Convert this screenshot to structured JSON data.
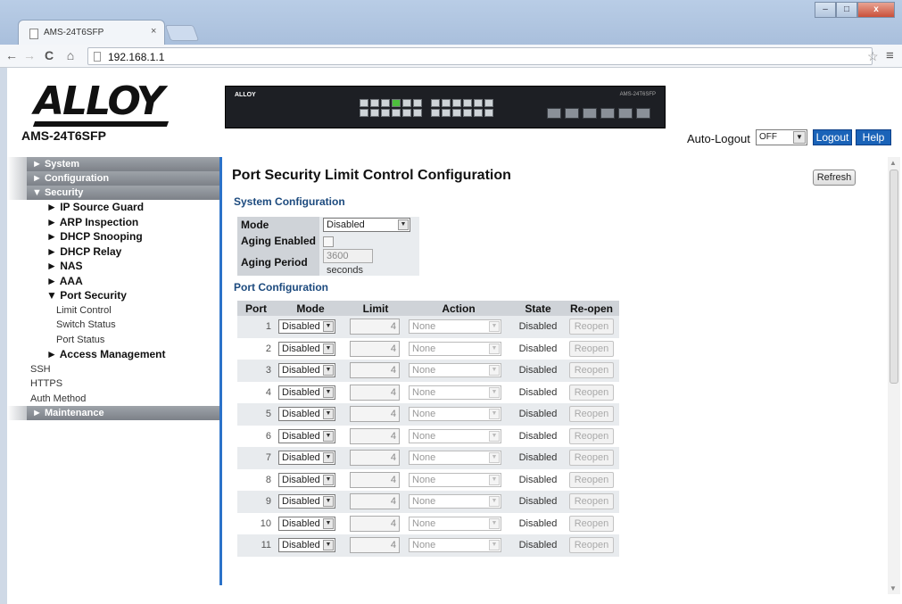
{
  "browser": {
    "tab_title": "AMS-24T6SFP",
    "close_glyph": "×",
    "url": "192.168.1.1",
    "back": "←",
    "forward": "→",
    "reload": "C",
    "home": "⌂",
    "star": "☆",
    "menu": "≡",
    "win_min": "–",
    "win_max": "□",
    "win_close": "x"
  },
  "header": {
    "logo": "ALLOY",
    "model": "AMS-24T6SFP",
    "switch_brand": "ALLOY",
    "switch_model": "AMS-24T6SFP",
    "auto_logout_label": "Auto-Logout",
    "auto_logout_value": "OFF",
    "logout_label": "Logout",
    "help_label": "Help"
  },
  "sidebar": {
    "system": "► System",
    "configuration": "► Configuration",
    "security": "▼ Security",
    "ip_source_guard": "► IP Source Guard",
    "arp_inspection": "► ARP Inspection",
    "dhcp_snooping": "► DHCP Snooping",
    "dhcp_relay": "► DHCP Relay",
    "nas": "► NAS",
    "aaa": "► AAA",
    "port_security": "▼ Port Security",
    "limit_control": "Limit Control",
    "switch_status": "Switch Status",
    "port_status": "Port Status",
    "access_management": "► Access Management",
    "ssh": "SSH",
    "https": "HTTPS",
    "auth_method": "Auth Method",
    "maintenance": "► Maintenance"
  },
  "main": {
    "title": "Port Security Limit Control Configuration",
    "refresh_label": "Refresh",
    "system_config_title": "System Configuration",
    "mode_label": "Mode",
    "mode_value": "Disabled",
    "aging_enabled_label": "Aging Enabled",
    "aging_period_label": "Aging Period",
    "aging_period_value": "3600",
    "aging_period_unit": "seconds",
    "port_config_title": "Port Configuration",
    "columns": {
      "port": "Port",
      "mode": "Mode",
      "limit": "Limit",
      "action": "Action",
      "state": "State",
      "reopen": "Re-open"
    },
    "star_row": {
      "port": "*",
      "mode": "<>",
      "action": "<>"
    },
    "rows": [
      {
        "port": "1",
        "mode": "Disabled",
        "limit": "4",
        "action": "None",
        "state": "Disabled",
        "reopen": "Reopen"
      },
      {
        "port": "2",
        "mode": "Disabled",
        "limit": "4",
        "action": "None",
        "state": "Disabled",
        "reopen": "Reopen"
      },
      {
        "port": "3",
        "mode": "Disabled",
        "limit": "4",
        "action": "None",
        "state": "Disabled",
        "reopen": "Reopen"
      },
      {
        "port": "4",
        "mode": "Disabled",
        "limit": "4",
        "action": "None",
        "state": "Disabled",
        "reopen": "Reopen"
      },
      {
        "port": "5",
        "mode": "Disabled",
        "limit": "4",
        "action": "None",
        "state": "Disabled",
        "reopen": "Reopen"
      },
      {
        "port": "6",
        "mode": "Disabled",
        "limit": "4",
        "action": "None",
        "state": "Disabled",
        "reopen": "Reopen"
      },
      {
        "port": "7",
        "mode": "Disabled",
        "limit": "4",
        "action": "None",
        "state": "Disabled",
        "reopen": "Reopen"
      },
      {
        "port": "8",
        "mode": "Disabled",
        "limit": "4",
        "action": "None",
        "state": "Disabled",
        "reopen": "Reopen"
      },
      {
        "port": "9",
        "mode": "Disabled",
        "limit": "4",
        "action": "None",
        "state": "Disabled",
        "reopen": "Reopen"
      },
      {
        "port": "10",
        "mode": "Disabled",
        "limit": "4",
        "action": "None",
        "state": "Disabled",
        "reopen": "Reopen"
      },
      {
        "port": "11",
        "mode": "Disabled",
        "limit": "4",
        "action": "None",
        "state": "Disabled",
        "reopen": "Reopen"
      }
    ]
  },
  "colors": {
    "accent": "#1a63b8",
    "sidebar_head": "#8a8f96",
    "section_title": "#1c4a7e"
  },
  "icons": {
    "select_arrow": "▼"
  }
}
